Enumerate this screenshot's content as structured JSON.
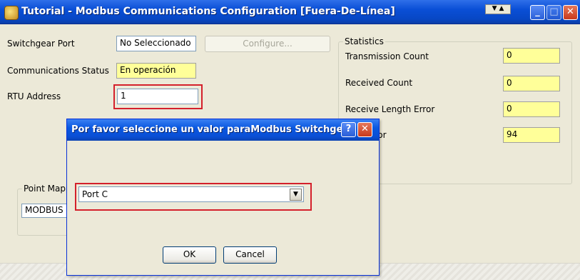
{
  "main_window": {
    "title": "Tutorial - Modbus Communications Configuration [Fuera-De-Línea]",
    "title_controls": {
      "dropdown_a": "▼",
      "dropdown_b": "▲",
      "minimize": "_",
      "maximize": "□",
      "close": "✕"
    },
    "fields": {
      "switchgear_port_label": "Switchgear Port",
      "switchgear_port_value": "No Seleccionado",
      "configure_button": "Configure...",
      "comm_status_label": "Communications Status",
      "comm_status_value": "En operación",
      "rtu_address_label": "RTU Address",
      "rtu_address_value": "1"
    },
    "point_mapping": {
      "legend": "Point Mapp",
      "value": "MODBUS S"
    },
    "statistics": {
      "legend": "Statistics",
      "rows": [
        {
          "label": "Transmission Count",
          "value": "0"
        },
        {
          "label": "Received Count",
          "value": "0"
        },
        {
          "label": "Receive Length Error",
          "value": "0"
        },
        {
          "label": "CRC Error",
          "value": "94"
        }
      ]
    }
  },
  "dialog": {
    "title": "Por favor seleccione un valor paraModbus Switchgear",
    "help_icon": "?",
    "close_icon": "✕",
    "select_value": "Port C",
    "ok_label": "OK",
    "cancel_label": "Cancel"
  },
  "colors": {
    "highlight_outline": "#d4202b",
    "readonly_field": "#ffff99",
    "titlebar": "#0a4fd6"
  }
}
